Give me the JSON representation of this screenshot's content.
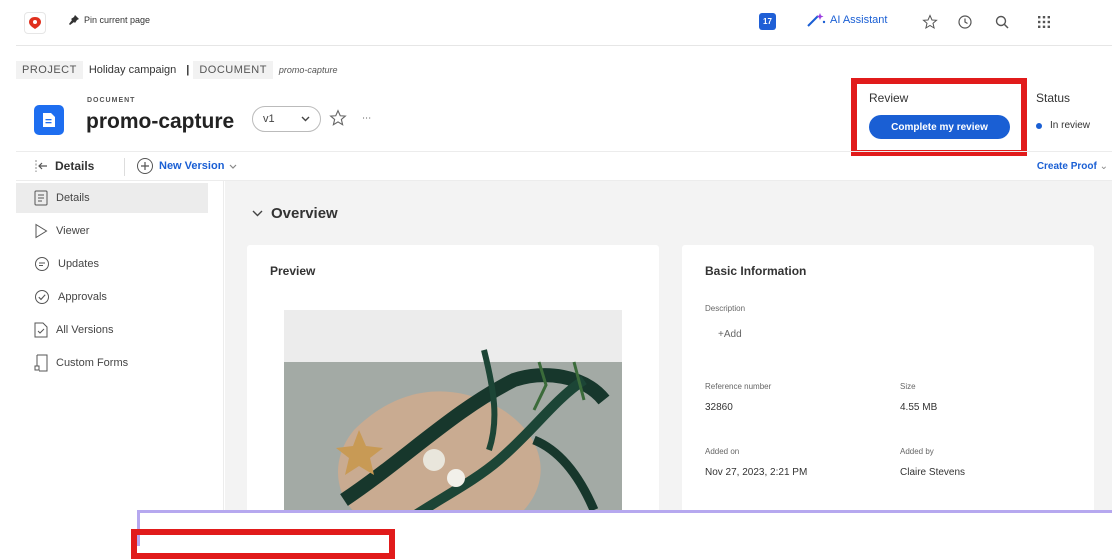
{
  "topbar": {
    "pin_label": "Pin current page",
    "notifications_count": "17",
    "ai_assistant_label": "AI Assistant",
    "icons": [
      "app-logo-icon",
      "pin-icon",
      "ai-sparkle-icon",
      "star-icon",
      "history-icon",
      "search-icon",
      "apps-grid-icon"
    ]
  },
  "breadcrumb": {
    "project_key": "PROJECT",
    "project_name": "Holiday campaign",
    "separator": "|",
    "document_key": "DOCUMENT",
    "document_name": "promo-capture"
  },
  "header": {
    "type_label": "DOCUMENT",
    "title": "promo-capture",
    "version": "v1",
    "more": "∙∙∙"
  },
  "review": {
    "label": "Review",
    "button": "Complete my review"
  },
  "status": {
    "label": "Status",
    "value": "In review"
  },
  "subbar": {
    "details_label": "Details",
    "new_version_label": "New Version",
    "create_proof_label": "Create Proof"
  },
  "sidebar": {
    "items": [
      {
        "label": "Details",
        "icon": "details-icon",
        "active": true
      },
      {
        "label": "Viewer",
        "icon": "viewer-icon"
      },
      {
        "label": "Updates",
        "icon": "updates-icon"
      },
      {
        "label": "Approvals",
        "icon": "approvals-icon"
      },
      {
        "label": "All Versions",
        "icon": "versions-icon"
      },
      {
        "label": "Custom Forms",
        "icon": "forms-icon"
      }
    ]
  },
  "overview": {
    "title": "Overview",
    "preview_title": "Preview",
    "basic_info": {
      "title": "Basic Information",
      "description_label": "Description",
      "description_add": "+Add",
      "reference_label": "Reference number",
      "reference_value": "32860",
      "size_label": "Size",
      "size_value": "4.55 MB",
      "added_on_label": "Added on",
      "added_on_value": "Nov 27, 2023, 2:21 PM",
      "added_by_label": "Added by",
      "added_by_value": "Claire Stevens"
    }
  },
  "colors": {
    "accent": "#1a5fd4",
    "highlight_red": "#e11b1b",
    "overlay_purple": "#b6a8ef"
  }
}
